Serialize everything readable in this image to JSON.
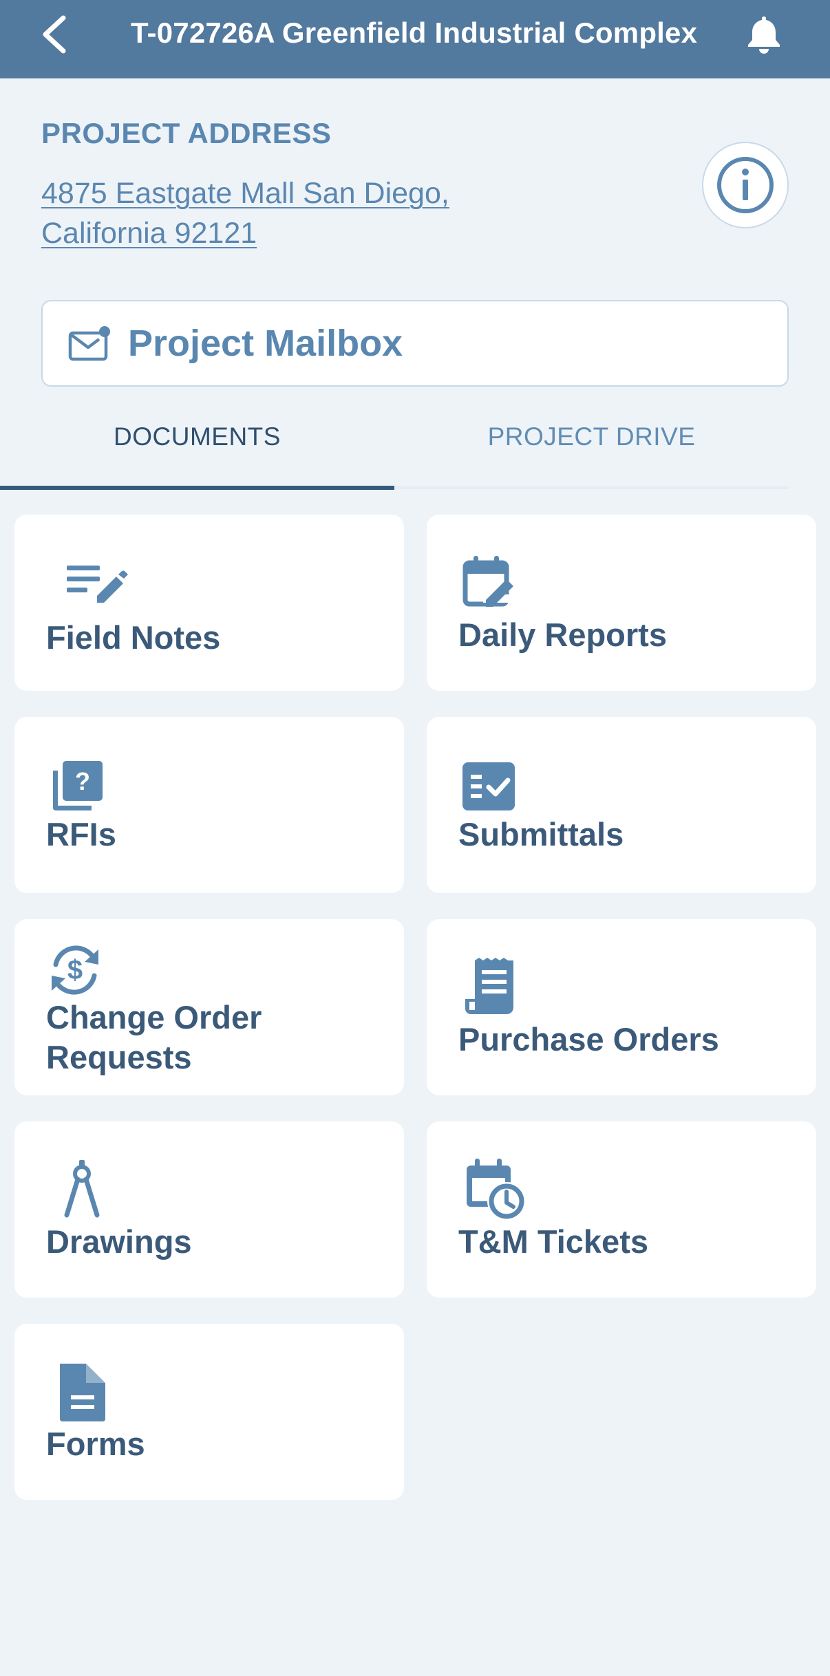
{
  "header": {
    "title": "T-072726A Greenfield Industrial Complex"
  },
  "project": {
    "address_label": "PROJECT ADDRESS",
    "address_line1": "4875 Eastgate Mall  San Diego,",
    "address_line2": "California 92121"
  },
  "mailbox": {
    "label": "Project Mailbox"
  },
  "tabs": [
    {
      "label": "DOCUMENTS",
      "active": true
    },
    {
      "label": "PROJECT DRIVE",
      "active": false
    }
  ],
  "modules": [
    {
      "label": "Field Notes",
      "icon": "notes-edit-icon"
    },
    {
      "label": "Daily Reports",
      "icon": "calendar-edit-icon"
    },
    {
      "label": "RFIs",
      "icon": "question-book-icon"
    },
    {
      "label": "Submittals",
      "icon": "checklist-icon"
    },
    {
      "label_line1": "Change Order",
      "label_line2": "Requests",
      "icon": "dollar-cycle-icon"
    },
    {
      "label": "Purchase Orders",
      "icon": "receipt-icon"
    },
    {
      "label": "Drawings",
      "icon": "compass-icon"
    },
    {
      "label": "T&M Tickets",
      "icon": "calendar-clock-icon"
    },
    {
      "label": "Forms",
      "icon": "document-icon"
    }
  ],
  "colors": {
    "header_bg": "#52799e",
    "accent": "#5a87b0",
    "text_dark": "#3b5a7a",
    "page_bg": "#eef3f8"
  }
}
